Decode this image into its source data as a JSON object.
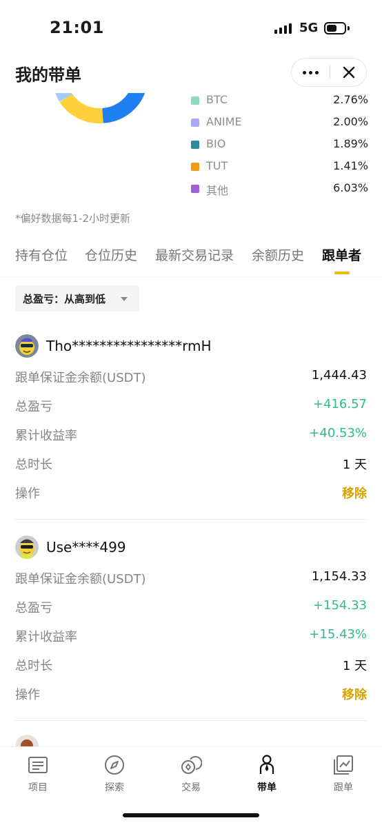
{
  "status_bar": {
    "time": "21:01",
    "network": "5G"
  },
  "header": {
    "title": "我的带单"
  },
  "allocation": {
    "colors": {
      "light_blue": "#a3cdf6",
      "yellow": "#ffd03b",
      "blue": "#1f7ef0"
    },
    "legend": [
      {
        "label": "BTC",
        "value": "2.76%",
        "color": "#8fd9bd"
      },
      {
        "label": "ANIME",
        "value": "2.00%",
        "color": "#a9a8f6"
      },
      {
        "label": "BIO",
        "value": "1.89%",
        "color": "#2c8a9e"
      },
      {
        "label": "TUT",
        "value": "1.41%",
        "color": "#f39a12"
      },
      {
        "label": "其他",
        "value": "6.03%",
        "color": "#a25fd6"
      }
    ],
    "note": "*偏好数据每1-2小时更新"
  },
  "tabs": [
    {
      "label": "持有仓位"
    },
    {
      "label": "仓位历史"
    },
    {
      "label": "最新交易记录"
    },
    {
      "label": "余额历史"
    },
    {
      "label": "跟单者"
    }
  ],
  "sort": {
    "label": "总盈亏：从高到低"
  },
  "followers": [
    {
      "name": "Tho****************rmH",
      "rows": [
        {
          "label": "跟单保证金余额(USDT)",
          "value": "1,444.43"
        },
        {
          "label": "总盈亏",
          "value": "+416.57"
        },
        {
          "label": "累计收益率",
          "value": "+40.53%"
        },
        {
          "label": "总时长",
          "value": "1 天"
        },
        {
          "label": "操作",
          "value": "移除"
        }
      ]
    },
    {
      "name": "Use****499",
      "rows": [
        {
          "label": "跟单保证金余额(USDT)",
          "value": "1,154.33"
        },
        {
          "label": "总盈亏",
          "value": "+154.33"
        },
        {
          "label": "累计收益率",
          "value": "+15.43%"
        },
        {
          "label": "总时长",
          "value": "1 天"
        },
        {
          "label": "操作",
          "value": "移除"
        }
      ]
    }
  ],
  "bottom_nav": [
    {
      "label": "项目",
      "icon": "list-icon"
    },
    {
      "label": "探索",
      "icon": "compass-icon"
    },
    {
      "label": "交易",
      "icon": "coins-icon"
    },
    {
      "label": "带单",
      "icon": "person-icon"
    },
    {
      "label": "跟单",
      "icon": "chart-window-icon"
    }
  ],
  "colors": {
    "accent": "#f0b90b",
    "positive": "#2ebd85",
    "action": "#d9a400"
  }
}
